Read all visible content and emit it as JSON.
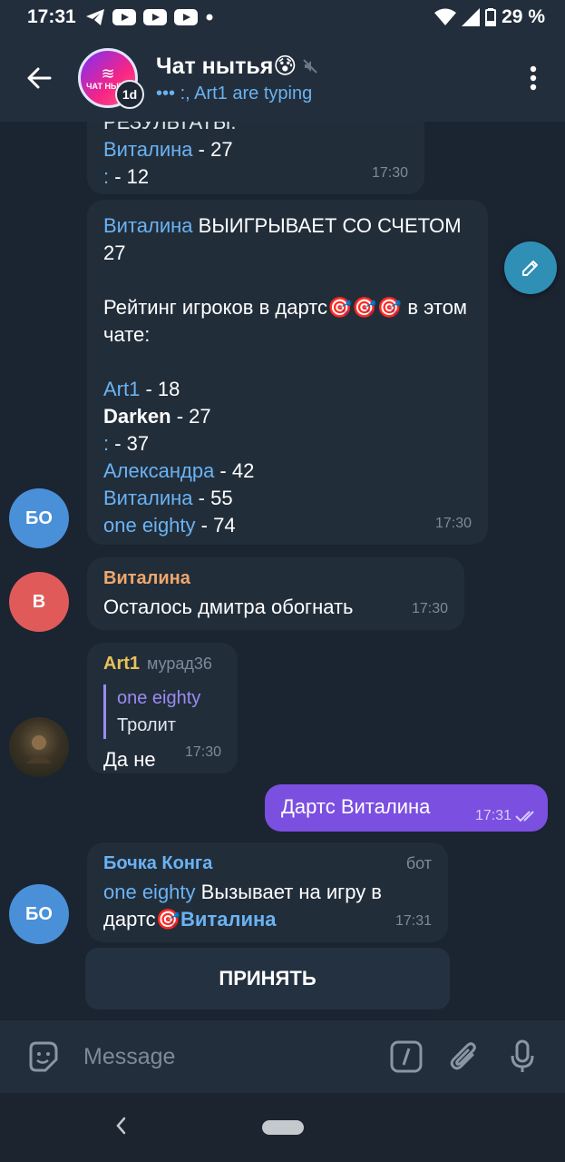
{
  "status_bar": {
    "time": "17:31",
    "battery": "29 %"
  },
  "header": {
    "title": "Чат нытья😰",
    "subtitle": "••• :, Art1 are typing",
    "avatar_logo": "ЧАТ НЫТЬ",
    "timer": "1d"
  },
  "messages": {
    "m1": {
      "line0": "РЕЗУЛЬТАТЫ:",
      "line1_name": "Виталина",
      "line1_val": " - 27",
      "line2_name": ":",
      "line2_val": " - 12",
      "time": "17:30"
    },
    "m2": {
      "winner_name": "Виталина",
      "winner_text": " ВЫИГРЫВАЕТ СО СЧЕТОМ 27",
      "rating_text": "Рейтинг игроков в дартс🎯🎯🎯 в этом чате:",
      "rows": [
        {
          "name": "Art1",
          "val": " - 18"
        },
        {
          "name": "Darken",
          "val": " - 27"
        },
        {
          "name": ":",
          "val": " - 37"
        },
        {
          "name": "Александра",
          "val": " - 42"
        },
        {
          "name": "Виталина",
          "val": " - 55"
        },
        {
          "name": "one eighty",
          "val": " - 74"
        }
      ],
      "time": "17:30",
      "avatar": "БО"
    },
    "m3": {
      "sender": "Виталина",
      "text": "Осталось дмитра обогнать",
      "time": "17:30",
      "avatar": "В"
    },
    "m4": {
      "sender": "Art1",
      "sender_tag": "мурад36",
      "reply_name": "one eighty",
      "reply_text": "Тролит",
      "text": "Да не",
      "time": "17:30"
    },
    "m5": {
      "text": "Дартс Виталина",
      "time": "17:31"
    },
    "m6": {
      "sender": "Бочка Конга",
      "bot_label": "бот",
      "name1": "one eighty",
      "text1": " Вызывает на игру в дартс🎯",
      "name2": "Виталина",
      "time": "17:31",
      "avatar": "БО",
      "button": "ПРИНЯТЬ"
    }
  },
  "input": {
    "placeholder": "Message"
  },
  "colors": {
    "accent_blue": "#6ab3f3",
    "own_bubble": "#7b4fe0",
    "sender_orange": "#f0a86c",
    "sender_yellow": "#e8c25a"
  }
}
